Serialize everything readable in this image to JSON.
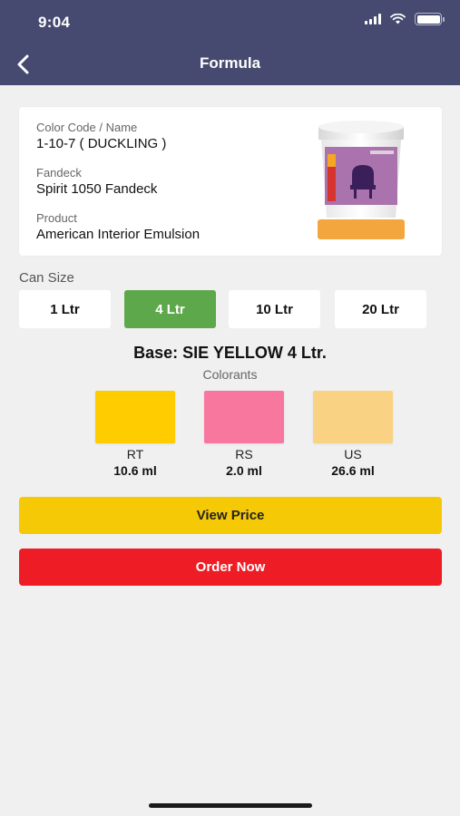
{
  "status_bar": {
    "time": "9:04"
  },
  "nav": {
    "title": "Formula",
    "back_icon": "chevron-left-icon"
  },
  "details": {
    "color_code_label": "Color Code / Name",
    "color_code_value": "1-10-7 ( DUCKLING )",
    "fandeck_label": "Fandeck",
    "fandeck_value": "Spirit 1050 Fandeck",
    "product_label": "Product",
    "product_value": "American Interior Emulsion"
  },
  "can_size": {
    "label": "Can Size",
    "options": [
      "1 Ltr",
      "4 Ltr",
      "10 Ltr",
      "20 Ltr"
    ],
    "selected": "4 Ltr"
  },
  "base": {
    "title": "Base: SIE YELLOW  4 Ltr."
  },
  "colorants": {
    "label": "Colorants",
    "items": [
      {
        "code": "RT",
        "amount": "10.6 ml",
        "color": "#ffcc00"
      },
      {
        "code": "RS",
        "amount": "2.0 ml",
        "color": "#f7779f"
      },
      {
        "code": "US",
        "amount": "26.6 ml",
        "color": "#f9d383"
      }
    ]
  },
  "actions": {
    "view_price": "View Price",
    "order_now": "Order Now"
  },
  "colors": {
    "header": "#464a70",
    "selected_size": "#5ea84c",
    "view_price": "#f5c906",
    "order_now": "#ed1c25"
  }
}
